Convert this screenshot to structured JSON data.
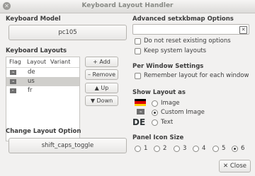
{
  "window": {
    "title": "Keyboard Layout Handler"
  },
  "model": {
    "heading": "Keyboard Model",
    "value": "pc105"
  },
  "layouts": {
    "heading": "Keyboard Layouts",
    "columns": [
      "Flag",
      "Layout",
      "Variant"
    ],
    "rows": [
      {
        "flag": "de",
        "code": "de",
        "selected": false
      },
      {
        "flag": "us",
        "code": "us",
        "selected": true
      },
      {
        "flag": "fr",
        "code": "fr",
        "selected": false
      }
    ],
    "buttons": {
      "add": "+ Add",
      "remove": "– Remove",
      "up": "▲ Up",
      "down": "▼ Down"
    }
  },
  "change_option": {
    "heading": "Change Layout Option",
    "value": "shift_caps_toggle"
  },
  "advanced": {
    "heading": "Advanced setxkbmap Options",
    "input_value": "",
    "no_reset": "Do not reset existing options",
    "keep_system": "Keep system layouts"
  },
  "per_window": {
    "heading": "Per Window Settings",
    "remember": "Remember layout for each window"
  },
  "show_as": {
    "heading": "Show Layout as",
    "image": "Image",
    "custom_image": "Custom Image",
    "text": "Text",
    "selected": "custom_image",
    "preview_text": "DE"
  },
  "panel_icon": {
    "heading": "Panel Icon Size",
    "sizes": [
      "1",
      "2",
      "3",
      "4",
      "5",
      "6"
    ],
    "selected": "6"
  },
  "footer": {
    "close": "Close"
  }
}
